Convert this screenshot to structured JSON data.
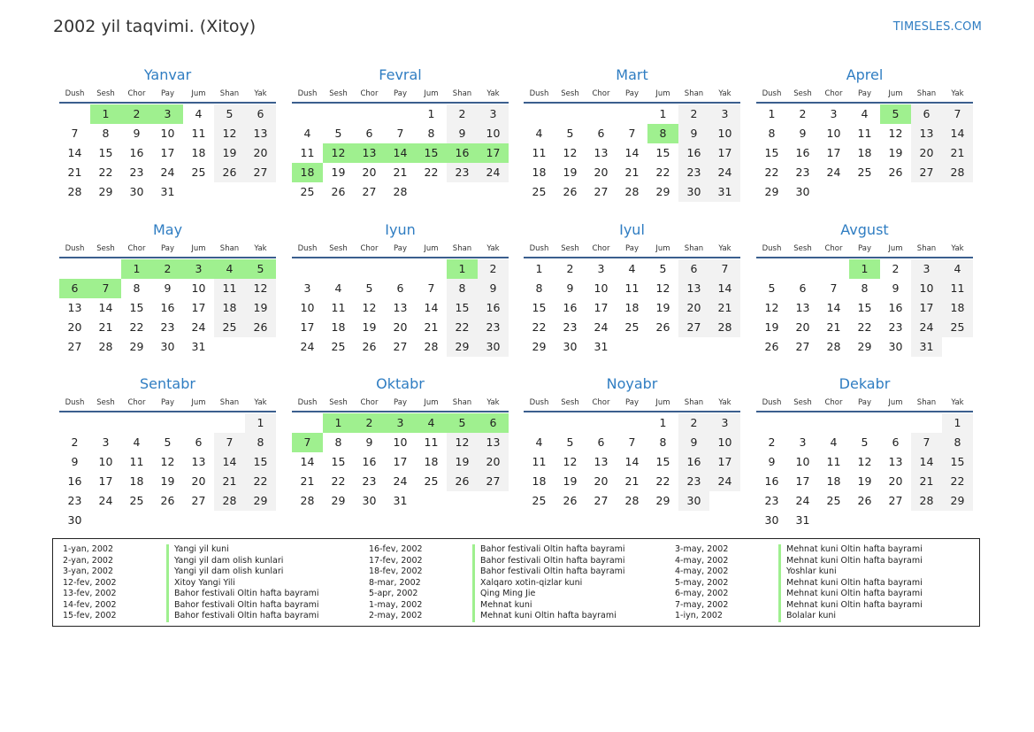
{
  "page": {
    "title": "2002 yil taqvimi. (Xitoy)",
    "brand": "TIMESLES.COM"
  },
  "weekday_labels": [
    "Dush",
    "Sesh",
    "Chor",
    "Pay",
    "Jum",
    "Shan",
    "Yak"
  ],
  "colors": {
    "accent": "#2f7dc2",
    "holiday": "#9ff08f",
    "weekend": "#f2f2f2",
    "rule": "#3b5f8e"
  },
  "months": [
    {
      "name": "Yanvar",
      "offset": 1,
      "days": 31,
      "holidays": [
        1,
        2,
        3
      ]
    },
    {
      "name": "Fevral",
      "offset": 4,
      "days": 28,
      "holidays": [
        12,
        13,
        14,
        15,
        16,
        17,
        18
      ]
    },
    {
      "name": "Mart",
      "offset": 4,
      "days": 31,
      "holidays": [
        8
      ]
    },
    {
      "name": "Aprel",
      "offset": 0,
      "days": 30,
      "holidays": [
        5
      ]
    },
    {
      "name": "May",
      "offset": 2,
      "days": 31,
      "holidays": [
        1,
        2,
        3,
        4,
        5,
        6,
        7
      ]
    },
    {
      "name": "Iyun",
      "offset": 5,
      "days": 30,
      "holidays": [
        1
      ]
    },
    {
      "name": "Iyul",
      "offset": 0,
      "days": 31,
      "holidays": []
    },
    {
      "name": "Avgust",
      "offset": 3,
      "days": 31,
      "holidays": [
        1
      ]
    },
    {
      "name": "Sentabr",
      "offset": 6,
      "days": 30,
      "holidays": []
    },
    {
      "name": "Oktabr",
      "offset": 1,
      "days": 31,
      "holidays": [
        1,
        2,
        3,
        4,
        5,
        6,
        7
      ]
    },
    {
      "name": "Noyabr",
      "offset": 4,
      "days": 30,
      "holidays": []
    },
    {
      "name": "Dekabr",
      "offset": 6,
      "days": 31,
      "holidays": []
    }
  ],
  "legend": [
    [
      {
        "date": "1-yan, 2002",
        "name": "Yangi yil kuni"
      },
      {
        "date": "2-yan, 2002",
        "name": "Yangi yil dam olish kunlari"
      },
      {
        "date": "3-yan, 2002",
        "name": "Yangi yil dam olish kunlari"
      },
      {
        "date": "12-fev, 2002",
        "name": "Xitoy Yangi Yili"
      },
      {
        "date": "13-fev, 2002",
        "name": "Bahor festivali Oltin hafta bayrami"
      },
      {
        "date": "14-fev, 2002",
        "name": "Bahor festivali Oltin hafta bayrami"
      },
      {
        "date": "15-fev, 2002",
        "name": "Bahor festivali Oltin hafta bayrami"
      }
    ],
    [
      {
        "date": "16-fev, 2002",
        "name": "Bahor festivali Oltin hafta bayrami"
      },
      {
        "date": "17-fev, 2002",
        "name": "Bahor festivali Oltin hafta bayrami"
      },
      {
        "date": "18-fev, 2002",
        "name": "Bahor festivali Oltin hafta bayrami"
      },
      {
        "date": "8-mar, 2002",
        "name": "Xalqaro xotin-qizlar kuni"
      },
      {
        "date": "5-apr, 2002",
        "name": "Qing Ming Jie"
      },
      {
        "date": "1-may, 2002",
        "name": "Mehnat kuni"
      },
      {
        "date": "2-may, 2002",
        "name": "Mehnat kuni Oltin hafta bayrami"
      }
    ],
    [
      {
        "date": "3-may, 2002",
        "name": "Mehnat kuni Oltin hafta bayrami"
      },
      {
        "date": "4-may, 2002",
        "name": "Mehnat kuni Oltin hafta bayrami"
      },
      {
        "date": "4-may, 2002",
        "name": "Yoshlar kuni"
      },
      {
        "date": "5-may, 2002",
        "name": "Mehnat kuni Oltin hafta bayrami"
      },
      {
        "date": "6-may, 2002",
        "name": "Mehnat kuni Oltin hafta bayrami"
      },
      {
        "date": "7-may, 2002",
        "name": "Mehnat kuni Oltin hafta bayrami"
      },
      {
        "date": "1-iyn, 2002",
        "name": "Bolalar kuni"
      }
    ]
  ]
}
